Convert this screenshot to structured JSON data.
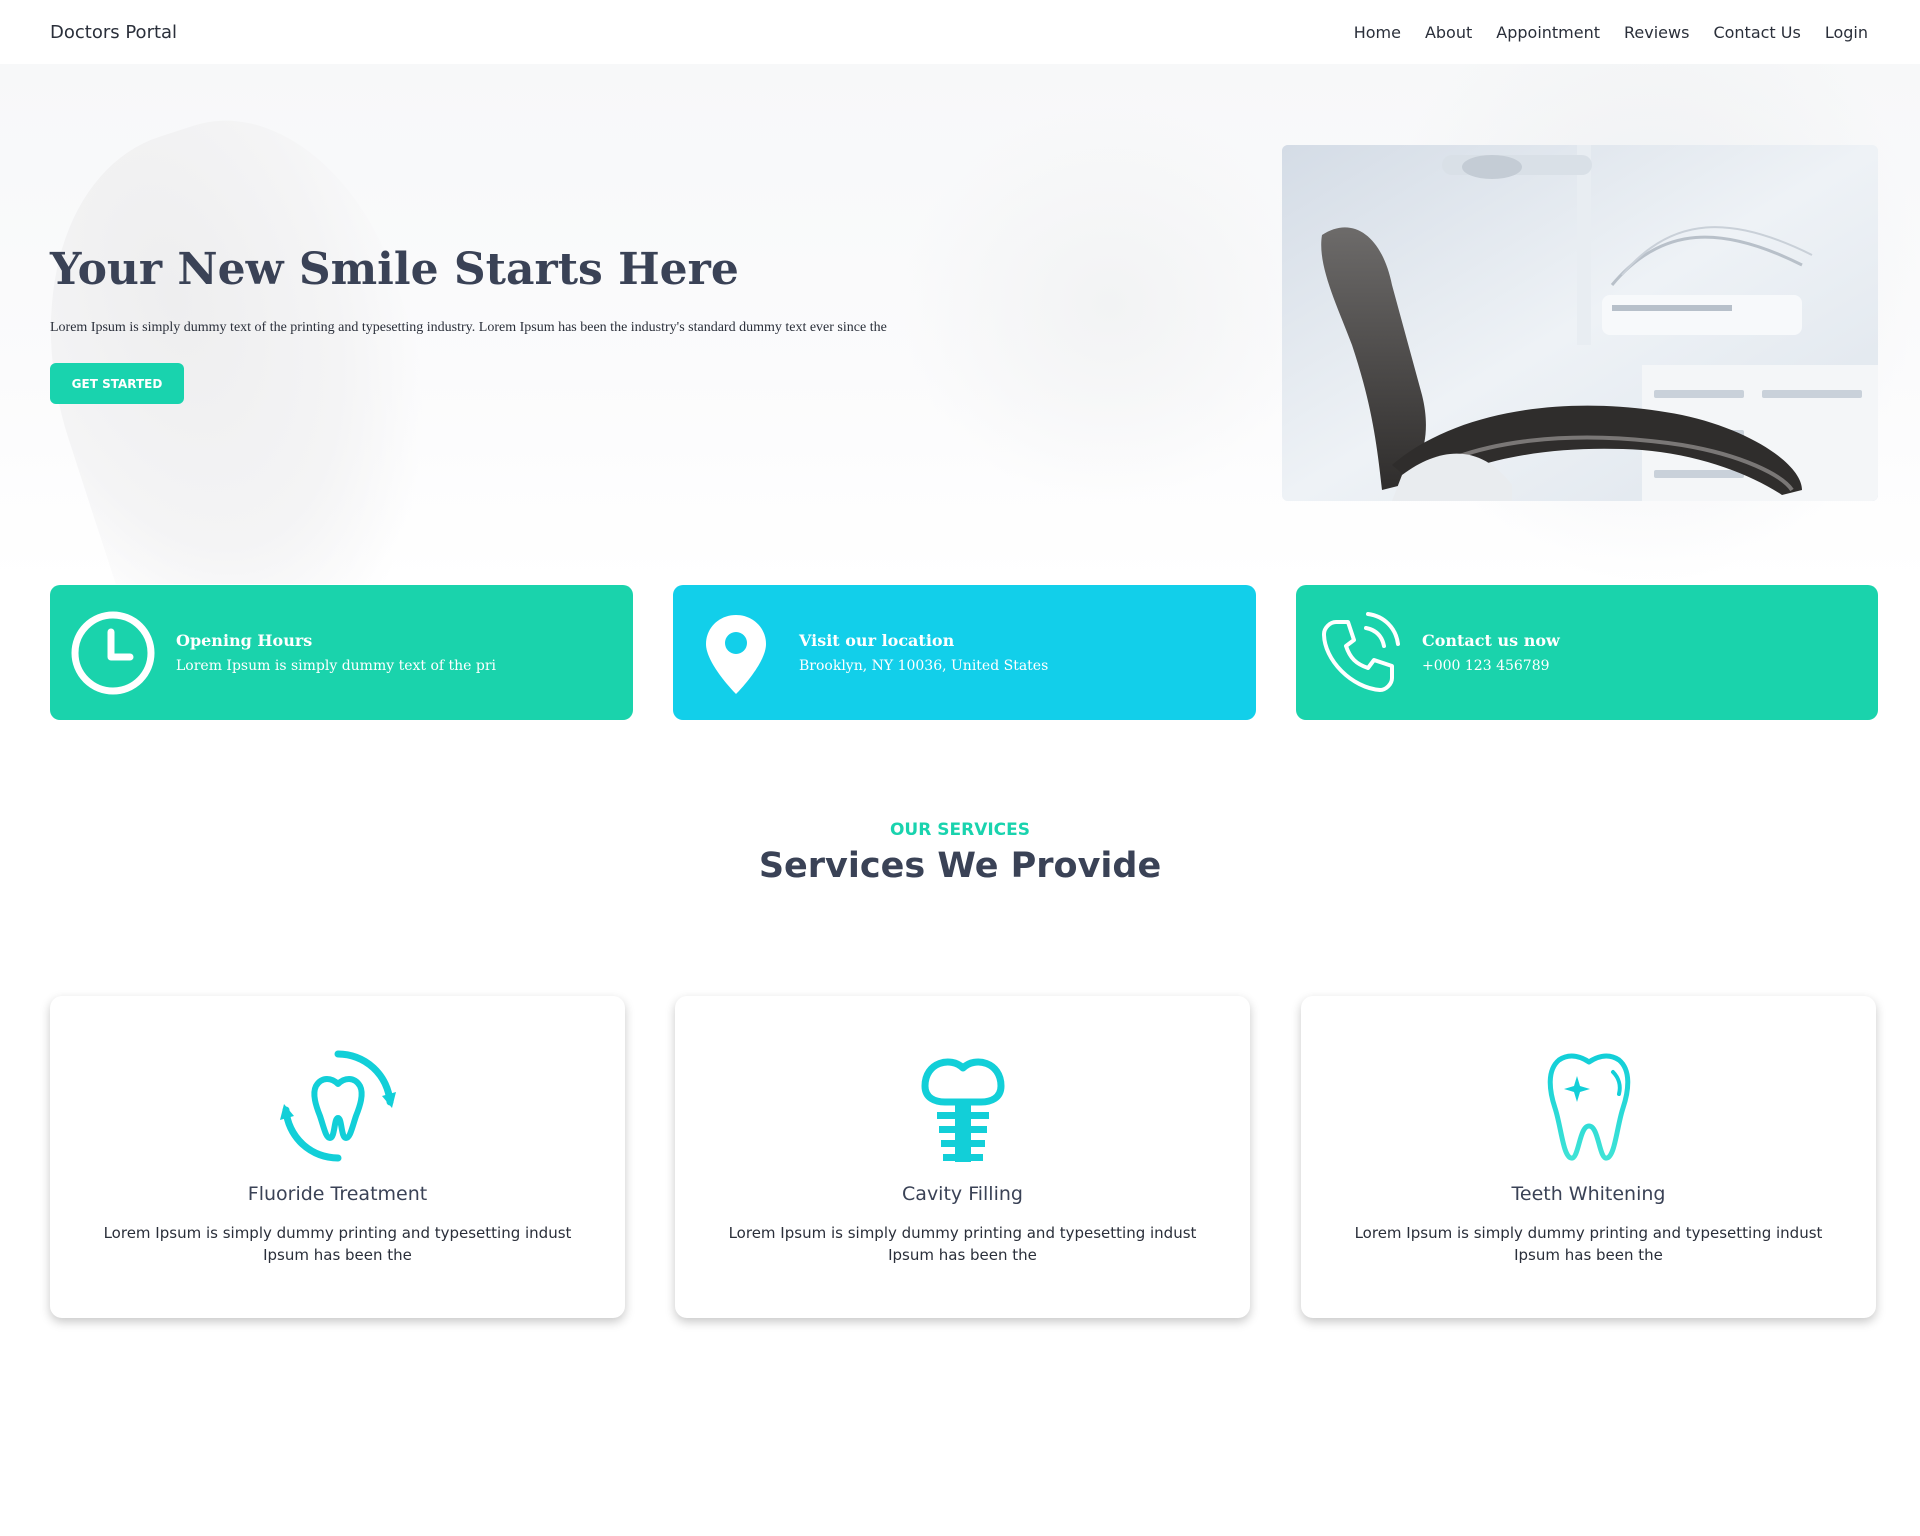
{
  "navbar": {
    "brand": "Doctors Portal",
    "links": [
      "Home",
      "About",
      "Appointment",
      "Reviews",
      "Contact Us",
      "Login"
    ]
  },
  "hero": {
    "title": "Your New Smile Starts Here",
    "text": "Lorem Ipsum is simply dummy text of the printing and typesetting industry. Lorem Ipsum has been the industry's standard dummy text ever since the",
    "button_label": "GET STARTED"
  },
  "info_cards": [
    {
      "title": "Opening Hours",
      "text": "Lorem Ipsum is simply dummy text of the pri",
      "icon": "clock-icon",
      "color": "#1ad3ac"
    },
    {
      "title": "Visit our location",
      "text": "Brooklyn, NY 10036, United States",
      "icon": "map-pin-icon",
      "color": "#12cfea"
    },
    {
      "title": "Contact us now",
      "text": "+000 123 456789",
      "icon": "phone-icon",
      "color": "#1ad3ac"
    }
  ],
  "services": {
    "subtitle": "OUR SERVICES",
    "title": "Services We Provide",
    "items": [
      {
        "title": "Fluoride Treatment",
        "text": "Lorem Ipsum is simply dummy printing and typesetting indust Ipsum has been the",
        "icon": "tooth-refresh-icon"
      },
      {
        "title": "Cavity Filling",
        "text": "Lorem Ipsum is simply dummy printing and typesetting indust Ipsum has been the",
        "icon": "tooth-implant-icon"
      },
      {
        "title": "Teeth Whitening",
        "text": "Lorem Ipsum is simply dummy printing and typesetting indust Ipsum has been the",
        "icon": "tooth-sparkle-icon"
      }
    ]
  },
  "colors": {
    "primary": "#19d3ae",
    "secondary": "#12cfea",
    "accent": "#3a4256"
  }
}
